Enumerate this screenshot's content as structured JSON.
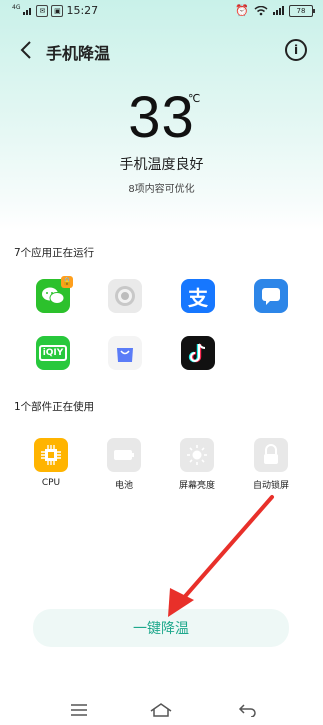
{
  "status_bar": {
    "network": "4G",
    "time": "15:27",
    "battery": "78"
  },
  "header": {
    "back_icon": "chevron-left-icon",
    "title": "手机降温",
    "info_icon": "info-icon"
  },
  "temperature": {
    "value": "33",
    "unit": "℃",
    "status": "手机温度良好",
    "subtitle": "8项内容可优化"
  },
  "running_apps": {
    "title": "7个应用正在运行",
    "apps": [
      {
        "name": "wechat-icon",
        "color": "#2cc12c"
      },
      {
        "name": "settings-icon",
        "color": "#eaeaea"
      },
      {
        "name": "alipay-icon",
        "color": "#1677ff"
      },
      {
        "name": "message-icon",
        "color": "#2d86e8"
      },
      {
        "name": "iqiyi-icon",
        "color": "#28c83c",
        "text": "iQIY"
      },
      {
        "name": "app-store-icon",
        "color": "#f4f4f4"
      },
      {
        "name": "tiktok-icon",
        "color": "#111111"
      }
    ],
    "alipay_glyph": "支"
  },
  "components": {
    "title": "1个部件正在使用",
    "items": [
      {
        "label": "CPU",
        "icon": "cpu-icon",
        "color": "#ffb400"
      },
      {
        "label": "电池",
        "icon": "battery-icon",
        "color": "#e8e8e8"
      },
      {
        "label": "屏幕亮度",
        "icon": "brightness-icon",
        "color": "#e8e8e8"
      },
      {
        "label": "自动锁屏",
        "icon": "lock-icon",
        "color": "#e8e8e8"
      }
    ]
  },
  "actions": {
    "cool_down": "一键降温"
  },
  "nav": {
    "menu_icon": "menu-icon",
    "home_icon": "home-icon",
    "back_icon": "back-icon"
  },
  "colors": {
    "accent": "#1ea88c",
    "arrow": "#e8302a"
  }
}
